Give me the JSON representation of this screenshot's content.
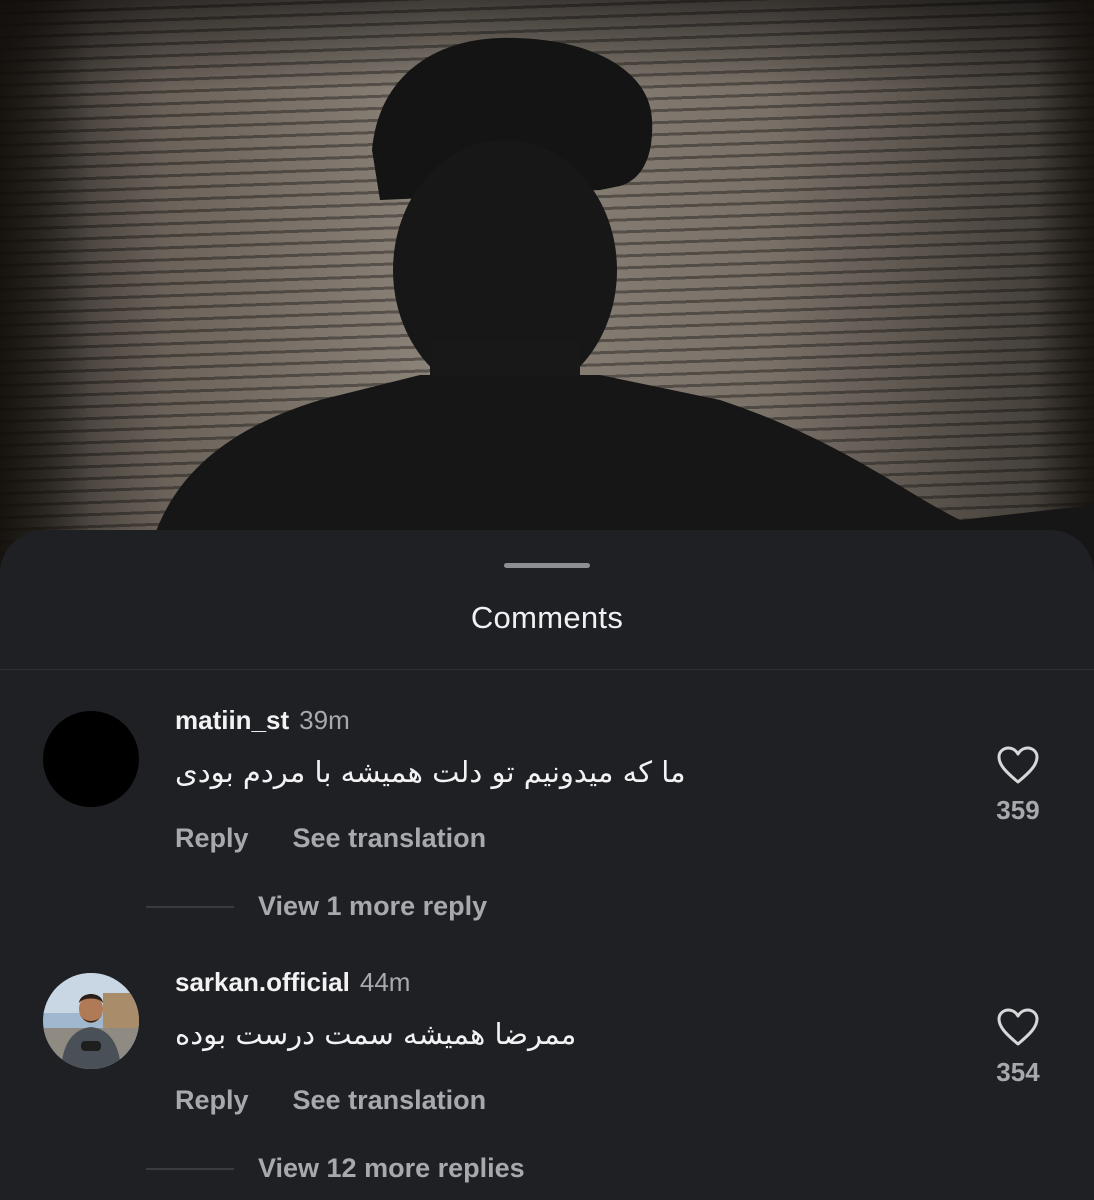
{
  "sheet": {
    "title": "Comments"
  },
  "comments": [
    {
      "username": "matiin_st",
      "time": "39m",
      "text": "ما که میدونیم تو دلت همیشه با مردم بودی",
      "reply_label": "Reply",
      "translate_label": "See translation",
      "likes": "359",
      "view_replies": "View 1 more reply",
      "avatar": "black-avatar"
    },
    {
      "username": "sarkan.official",
      "time": "44m",
      "text": "ممرضا همیشه سمت درست بوده",
      "reply_label": "Reply",
      "translate_label": "See translation",
      "likes": "354",
      "view_replies": "View 12 more replies",
      "avatar": "photo-avatar"
    }
  ],
  "colors": {
    "sheet_bg": "#1f2024",
    "primary_text": "#f2f2f4",
    "secondary_text": "#a8a9ae"
  },
  "icons": {
    "like": "heart-outline-icon",
    "handle": "drag-handle"
  }
}
